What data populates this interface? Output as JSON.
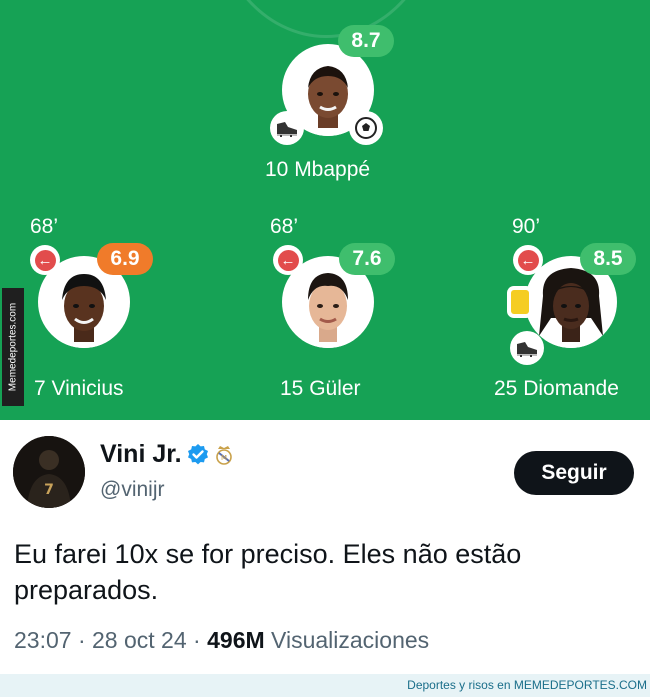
{
  "lineup": {
    "top_player": {
      "rating": "8.7",
      "name": "10 Mbappé",
      "rating_color": "#3fbe6d"
    },
    "players": [
      {
        "minute": "68’",
        "rating": "6.9",
        "name": "7 Vinicius",
        "rating_color": "#f07b2a"
      },
      {
        "minute": "68’",
        "rating": "7.6",
        "name": "15 Güler",
        "rating_color": "#3fbe6d"
      },
      {
        "minute": "90’",
        "rating": "8.5",
        "name": "25 Diomande",
        "rating_color": "#3fbe6d"
      }
    ],
    "icons": {
      "substitution": "sub-off-arrow-icon",
      "goal": "football-icon",
      "assist": "boot-icon",
      "card": "yellow-card-icon"
    },
    "pitch_color": "#16a255",
    "side_watermark": "Memedeportes.com"
  },
  "tweet": {
    "display_name": "Vini Jr.",
    "handle": "@vinijr",
    "follow_label": "Seguir",
    "text": "Eu farei 10x se for preciso. Eles não estão preparados.",
    "time": "23:07",
    "date": "28 oct 24",
    "separator": "·",
    "views_count": "496M",
    "views_label": "Visualizaciones"
  },
  "footer_credit": "Deportes y risos en MEMEDEPORTES.COM"
}
